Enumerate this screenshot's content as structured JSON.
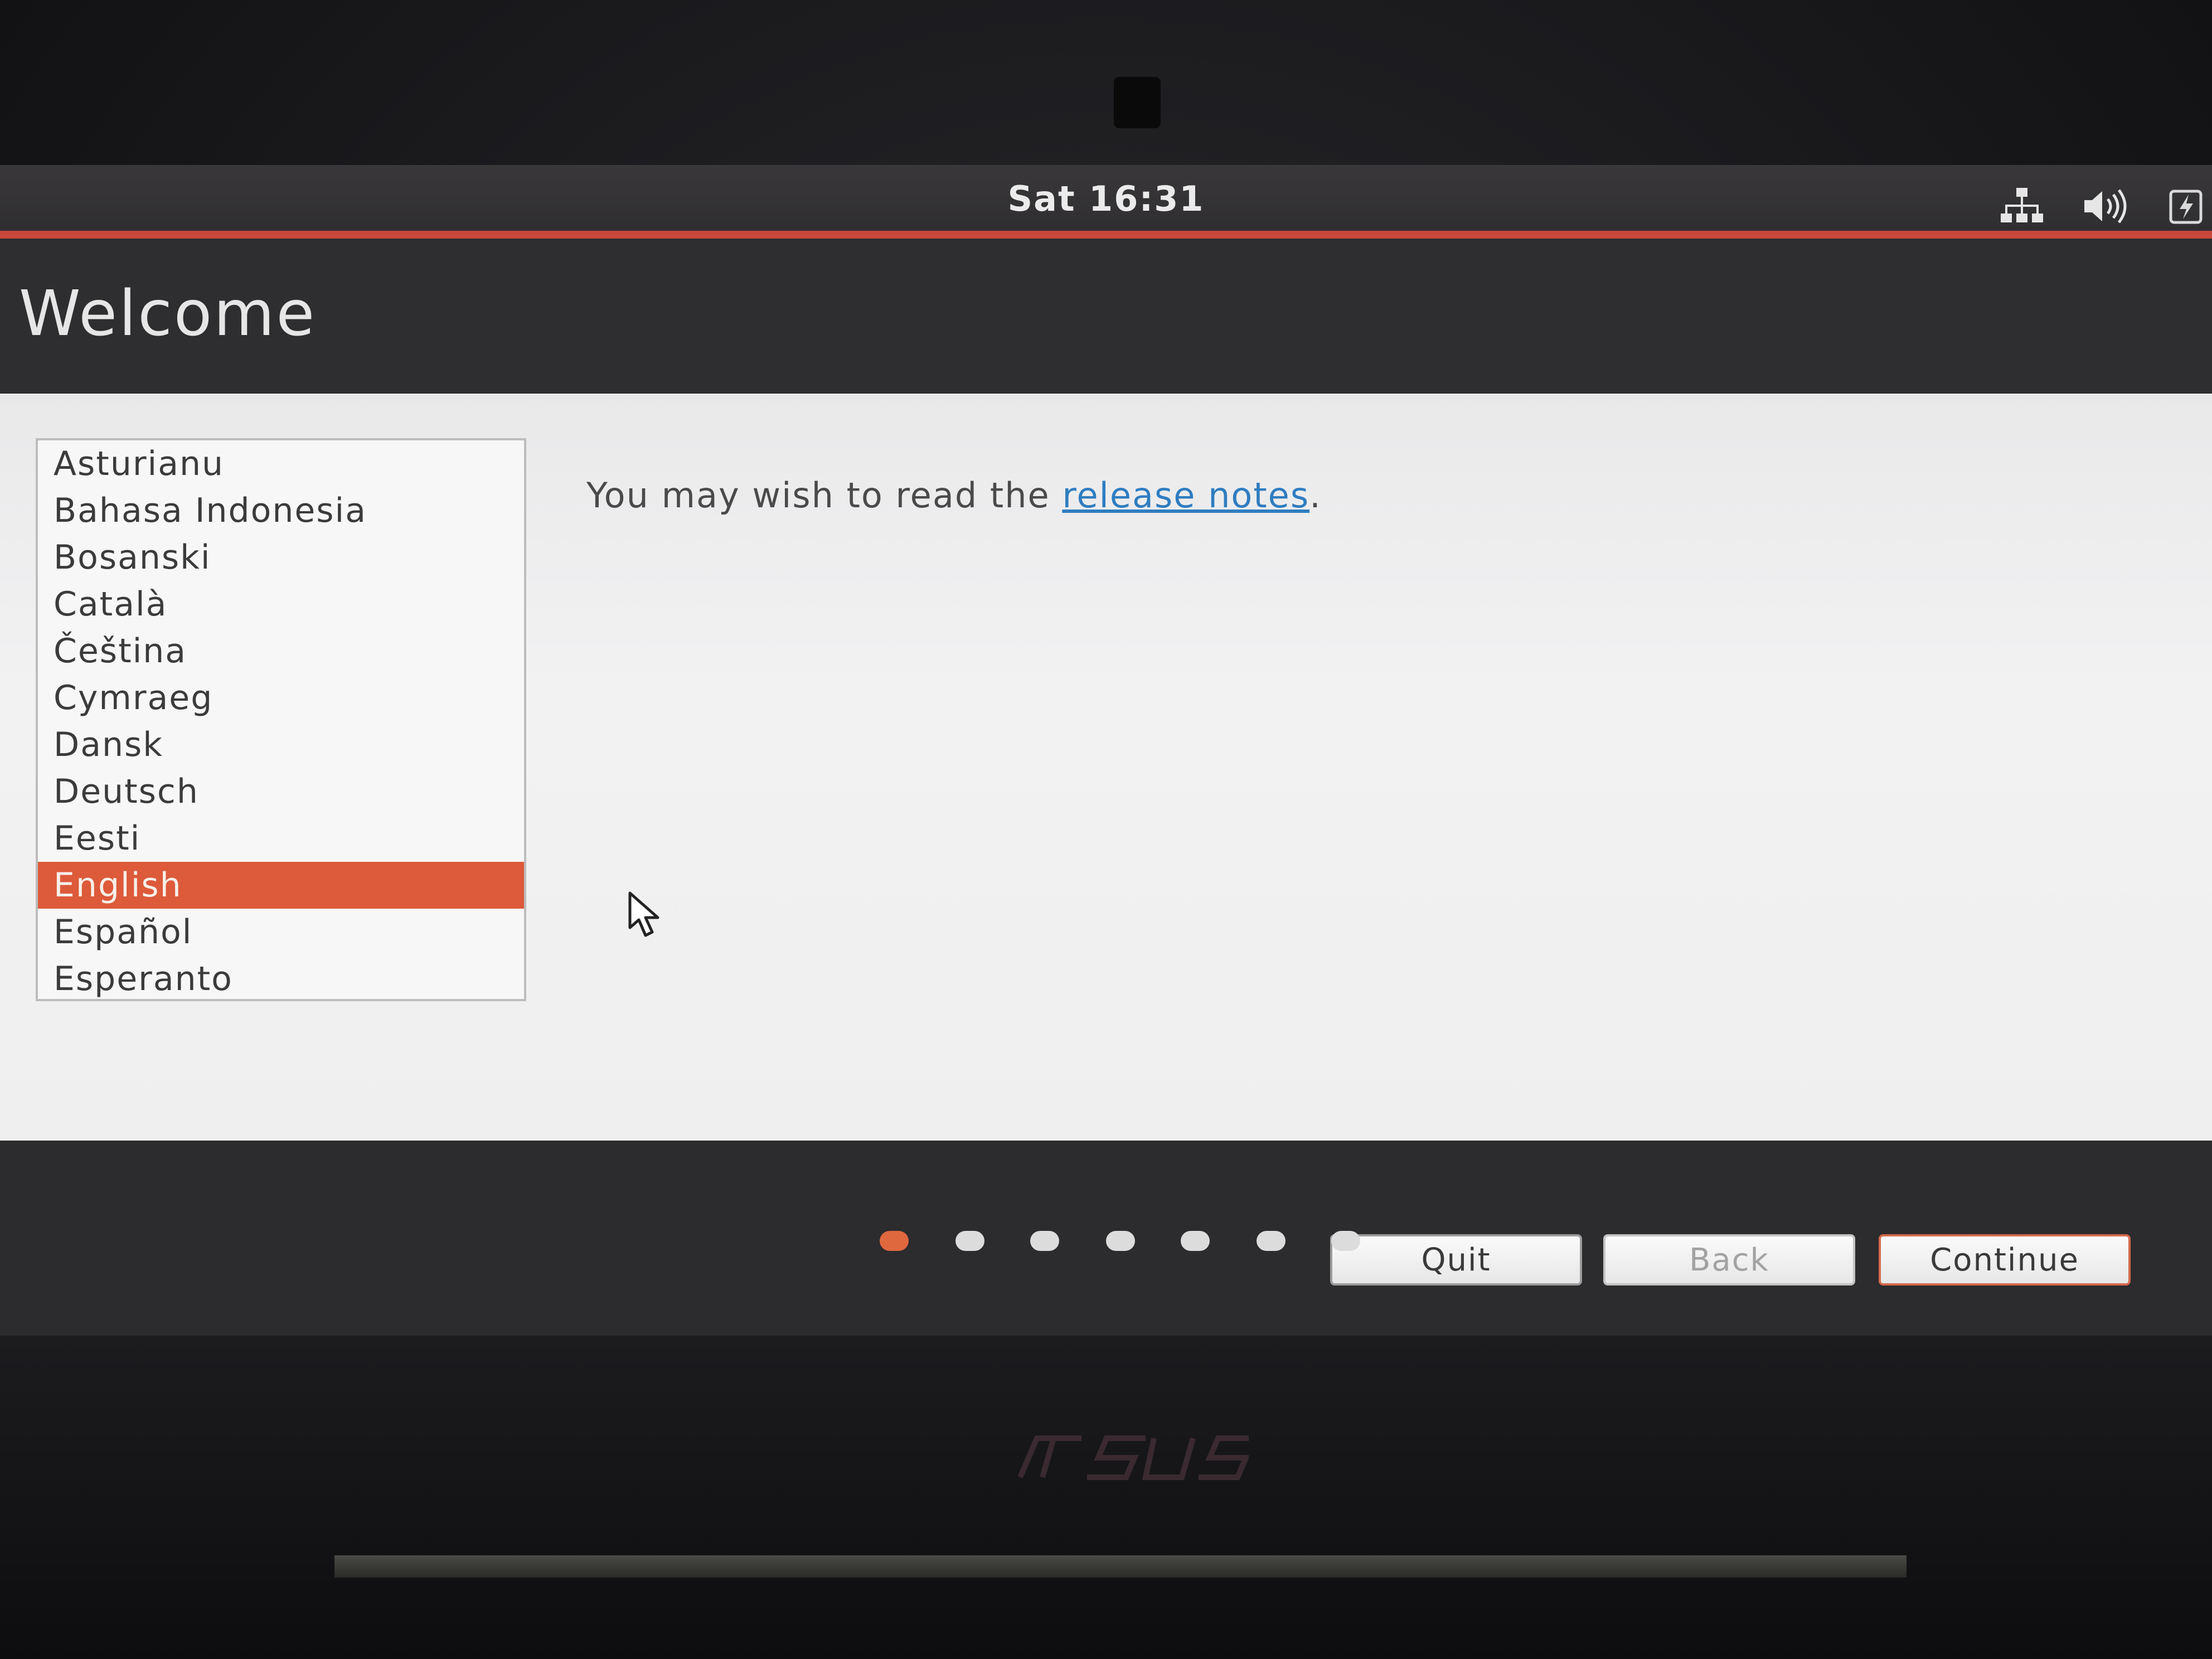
{
  "topbar": {
    "clock": "Sat 16:31",
    "tray_icons": [
      "network-icon",
      "volume-icon",
      "battery-icon"
    ]
  },
  "header": {
    "title": "Welcome"
  },
  "language_list": {
    "items": [
      "Asturianu",
      "Bahasa Indonesia",
      "Bosanski",
      "Català",
      "Čeština",
      "Cymraeg",
      "Dansk",
      "Deutsch",
      "Eesti",
      "English",
      "Español",
      "Esperanto"
    ],
    "selected": "English"
  },
  "release": {
    "prefix": "You may wish to read the ",
    "link_text": "release notes",
    "suffix": "."
  },
  "buttons": {
    "quit": "Quit",
    "back": "Back",
    "continue": "Continue"
  },
  "progress": {
    "total_steps": 7,
    "current_step": 1
  },
  "colors": {
    "accent": "#dd5a3a",
    "link": "#2f7dc0",
    "topbar_line": "#c9463a"
  }
}
